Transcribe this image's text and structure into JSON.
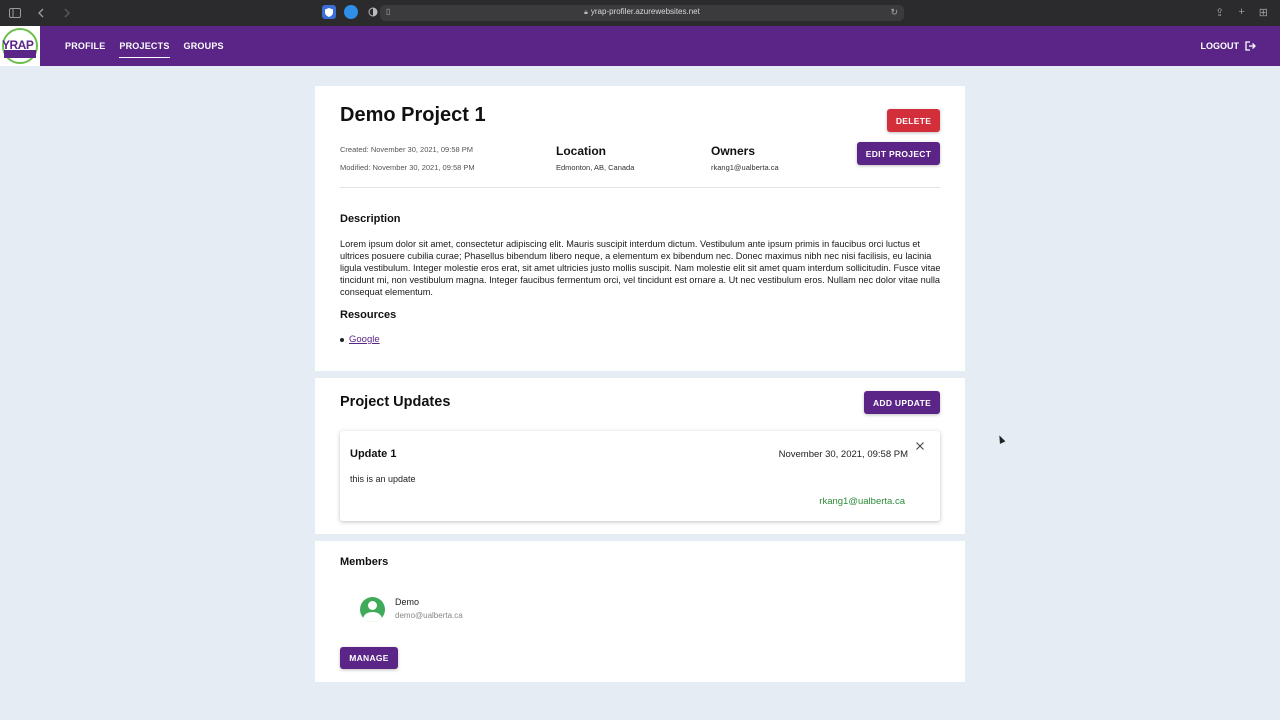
{
  "browser": {
    "url": "yrap-profiler.azurewebsites.net"
  },
  "appbar": {
    "logo_text": "YRAP",
    "nav": [
      {
        "label": "PROFILE"
      },
      {
        "label": "PROJECTS"
      },
      {
        "label": "GROUPS"
      }
    ],
    "logout_label": "LOGOUT"
  },
  "project": {
    "title": "Demo Project 1",
    "delete_label": "DELETE",
    "edit_label": "EDIT PROJECT",
    "created": "Created: November 30, 2021, 09:58 PM",
    "modified": "Modified: November 30, 2021, 09:58 PM",
    "location_heading": "Location",
    "location_value": "Edmonton, AB, Canada",
    "owners_heading": "Owners",
    "owners_value": "rkang1@ualberta.ca",
    "description_heading": "Description",
    "description_text": "Lorem ipsum dolor sit amet, consectetur adipiscing elit. Mauris suscipit interdum dictum. Vestibulum ante ipsum primis in faucibus orci luctus et ultrices posuere cubilia curae; Phasellus bibendum libero neque, a elementum ex bibendum nec. Donec maximus nibh nec nisi facilisis, eu lacinia ligula vestibulum. Integer molestie eros erat, sit amet ultricies justo mollis suscipit. Nam molestie elit sit amet quam interdum sollicitudin. Fusce vitae tincidunt mi, non vestibulum magna. Integer faucibus fermentum orci, vel tincidunt est ornare a. Ut nec vestibulum eros. Nullam nec dolor vitae nulla consequat elementum.",
    "resources_heading": "Resources",
    "resources": [
      {
        "label": "Google"
      }
    ]
  },
  "updates": {
    "title": "Project Updates",
    "add_label": "ADD UPDATE",
    "items": [
      {
        "title": "Update 1",
        "date": "November 30, 2021, 09:58 PM",
        "body": "this is an update",
        "author": "rkang1@ualberta.ca"
      }
    ]
  },
  "members": {
    "title": "Members",
    "items": [
      {
        "name": "Demo",
        "email": "demo@ualberta.ca"
      }
    ],
    "manage_label": "MANAGE"
  },
  "colors": {
    "primary": "#5a2587",
    "danger": "#d32f3b",
    "success": "#2e8b3a",
    "background": "#e5ecf3"
  }
}
